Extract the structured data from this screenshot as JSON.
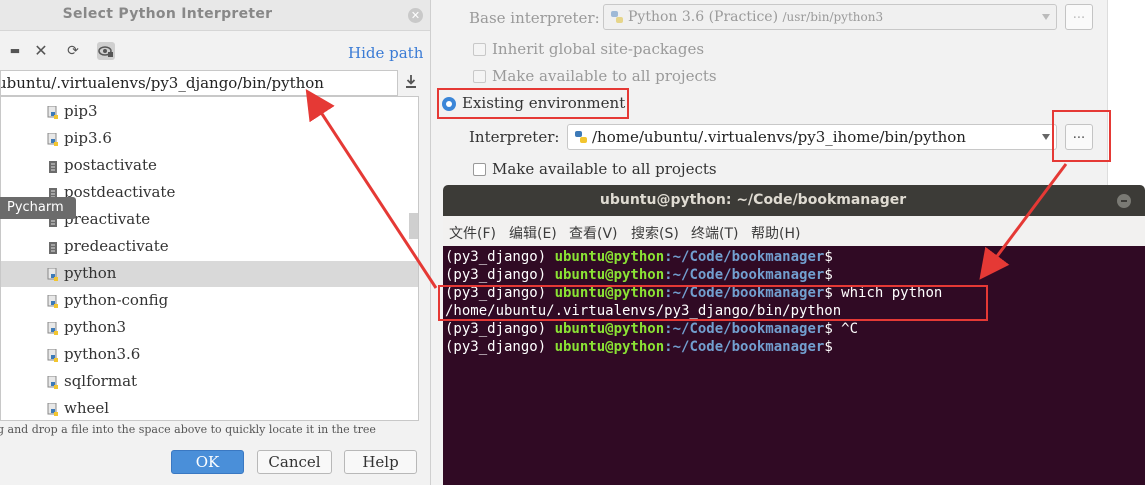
{
  "settings": {
    "base_interpreter_label": "Base interpreter:",
    "base_interpreter_value": "Python 3.6 (Practice)",
    "base_interpreter_path": "/usr/bin/python3",
    "inherit_label": "Inherit global site-packages",
    "make_available_label_1": "Make available to all projects",
    "existing_env_label": "Existing environment",
    "interpreter_label": "Interpreter:",
    "interpreter_value": "/home/ubuntu/.virtualenvs/py3_ihome/bin/python",
    "make_available_label_2": "Make available to all projects",
    "browse_label": "..."
  },
  "dialog": {
    "title": "Select Python Interpreter",
    "close_glyph": "✕",
    "hide_path": "Hide path",
    "path_value": "ubuntu/.virtualenvs/py3_django/bin/python",
    "hint": "g and drop a file into the space above to quickly locate it in the tree",
    "ok": "OK",
    "cancel": "Cancel",
    "help": "Help",
    "tooltip": "Pycharm",
    "files": [
      {
        "name": "pip3",
        "icon": "python-file-icon"
      },
      {
        "name": "pip3.6",
        "icon": "python-file-icon"
      },
      {
        "name": "postactivate",
        "icon": "text-file-icon"
      },
      {
        "name": "postdeactivate",
        "icon": "text-file-icon"
      },
      {
        "name": "preactivate",
        "icon": "text-file-icon"
      },
      {
        "name": "predeactivate",
        "icon": "text-file-icon"
      },
      {
        "name": "python",
        "icon": "python-file-icon",
        "selected": true
      },
      {
        "name": "python-config",
        "icon": "python-file-icon"
      },
      {
        "name": "python3",
        "icon": "python-file-icon"
      },
      {
        "name": "python3.6",
        "icon": "python-file-icon"
      },
      {
        "name": "sqlformat",
        "icon": "python-file-icon"
      },
      {
        "name": "wheel",
        "icon": "python-file-icon"
      }
    ]
  },
  "terminal": {
    "title": "ubuntu@python: ~/Code/bookmanager",
    "menu": [
      "文件(F)",
      "编辑(E)",
      "查看(V)",
      "搜索(S)",
      "终端(T)",
      "帮助(H)"
    ],
    "lines": [
      {
        "env": "(py3_django) ",
        "user": "ubuntu@python",
        "path": ":~/Code/bookmanager",
        "cmd": "$"
      },
      {
        "env": "(py3_django) ",
        "user": "ubuntu@python",
        "path": ":~/Code/bookmanager",
        "cmd": "$"
      },
      {
        "env": "(py3_django) ",
        "user": "ubuntu@python",
        "path": ":~/Code/bookmanager",
        "cmd": "$ which python"
      },
      {
        "output": "/home/ubuntu/.virtualenvs/py3_django/bin/python"
      },
      {
        "env": "(py3_django) ",
        "user": "ubuntu@python",
        "path": ":~/Code/bookmanager",
        "cmd": "$ ^C"
      },
      {
        "env": "(py3_django) ",
        "user": "ubuntu@python",
        "path": ":~/Code/bookmanager",
        "cmd": "$"
      }
    ]
  },
  "colors": {
    "annotation_red": "#e53935",
    "terminal_bg": "#300a24",
    "prompt_user": "#8ae234",
    "prompt_path": "#729fcf",
    "accent_blue": "#3b86d8"
  }
}
